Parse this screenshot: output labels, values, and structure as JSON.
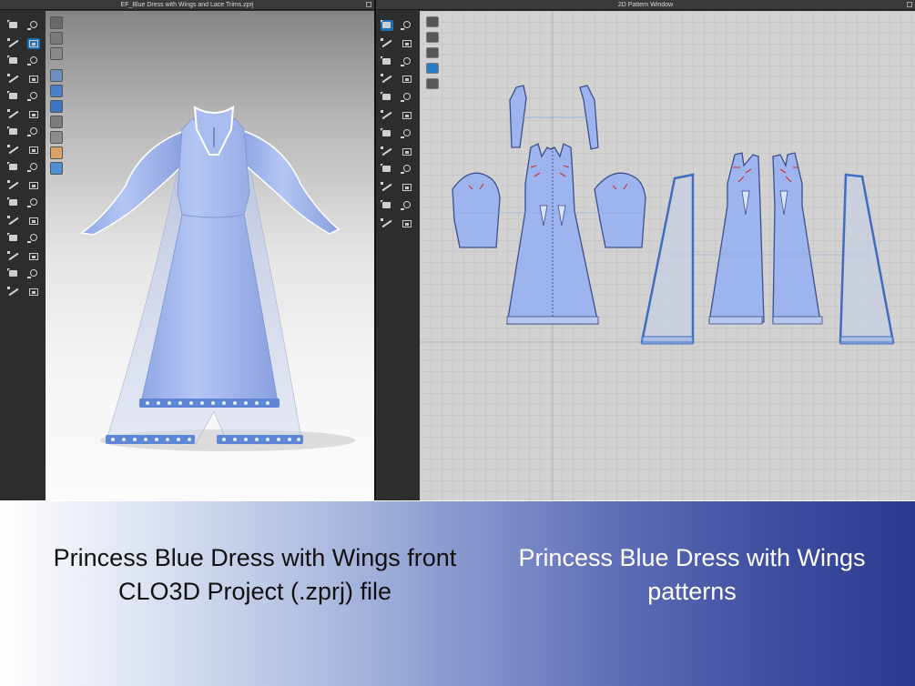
{
  "window_3d": {
    "title": "EF_Blue Dress with Wings and Lace Trims.zprj"
  },
  "window_2d": {
    "title": "2D Pattern Window"
  },
  "toolbar_3d": {
    "icons": [
      "select-move-icon",
      "tack-icon",
      "transform-icon",
      "add-pin-icon",
      "box-select-icon",
      "fold-arrange-icon",
      "steam-icon",
      "pin-icon",
      "tape-icon",
      "measure-icon",
      "avatar-icon",
      "puckering-icon",
      "pen-icon",
      "trim-icon",
      "brush-icon",
      "sewing-icon",
      "rotate-icon",
      "button-icon",
      "stitch-icon",
      "buttonhole-icon",
      "zipper-icon",
      "hanger-icon",
      "pipe-icon",
      "elastic-icon",
      "seam-taping-icon",
      "fabric-icon",
      "fold-icon",
      "texture-icon",
      "ruler-icon",
      "gauge-icon",
      "shirt-icon",
      "morph-icon"
    ]
  },
  "view_controls": {
    "icons": [
      "avatar-view-icon",
      "pattern-view-icon",
      "texture-view-icon",
      "shaded-view-icon",
      "stress-map-icon",
      "fitting-map-icon",
      "wireframe-icon",
      "xray-icon",
      "skin-view-icon",
      "sphere-view-icon"
    ]
  },
  "toolbar_2d": {
    "icons": [
      "select-pattern-icon",
      "edit-pattern-icon",
      "transform-pattern-icon",
      "edit-curve-icon",
      "polygon-icon",
      "rectangle-icon",
      "ellipse-icon",
      "dart-icon",
      "internal-line-icon",
      "notch-icon",
      "sewing-segment-icon",
      "free-sewing-icon",
      "trace-icon",
      "fold-pattern-icon",
      "grade-icon",
      "symmetry-icon",
      "text-icon",
      "annotation-icon",
      "measure-2d-icon",
      "arrange-icon",
      "grid-icon",
      "snap-icon",
      "lock-icon",
      "layer-icon"
    ]
  },
  "toolbar_2d_extra": {
    "icons": [
      "show-baseline-icon",
      "show-texture-icon",
      "show-fill-icon",
      "show-color-icon",
      "show-lock-icon"
    ]
  },
  "colors": {
    "dress_fill": "#9eb4ee",
    "dress_edge": "#3d4f8a",
    "trim_blue": "#5f86d6",
    "wing_fill": "#c7cfe8"
  },
  "captions": {
    "left": [
      "Princess Blue Dress with Wings front",
      "CLO3D Project (.zprj) file"
    ],
    "right": [
      "Princess Blue Dress with Wings",
      "patterns"
    ]
  }
}
